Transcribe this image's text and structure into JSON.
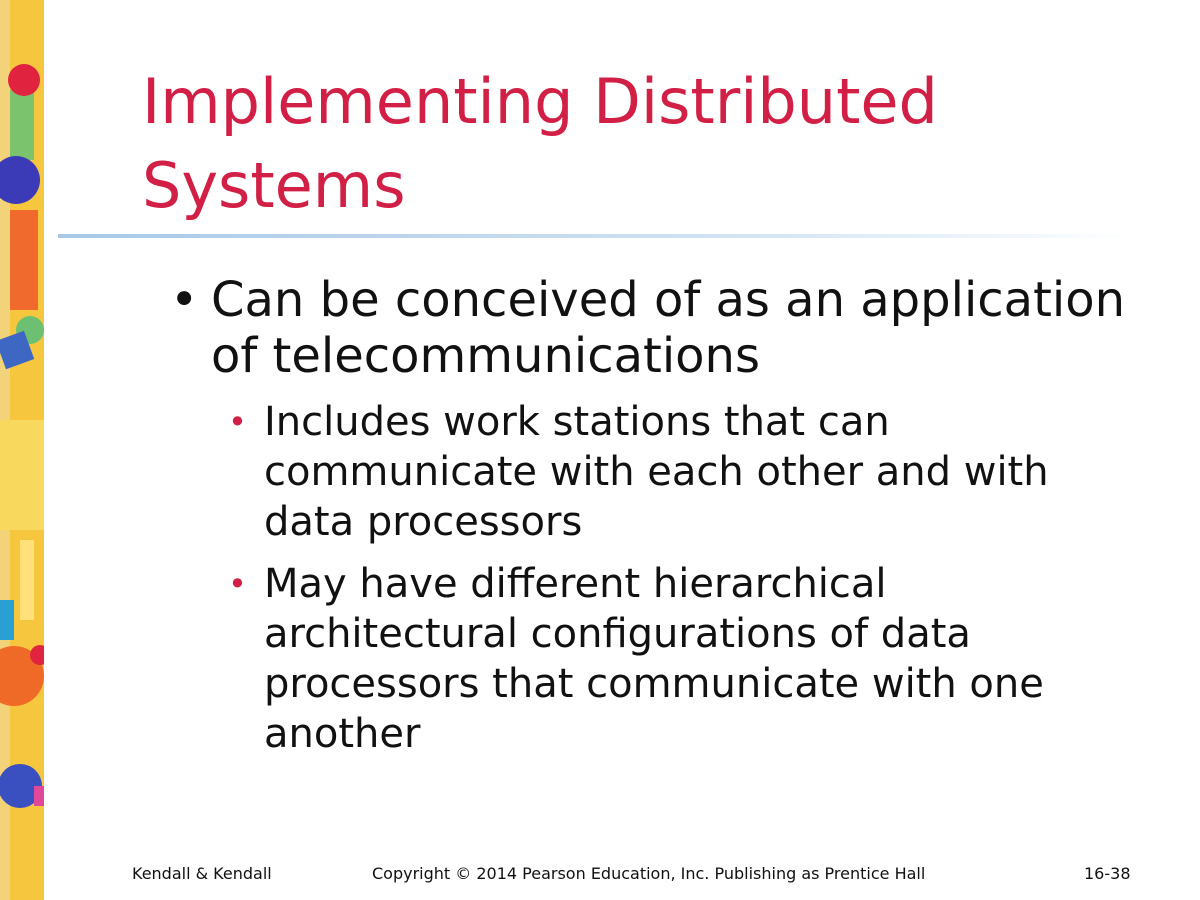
{
  "slide": {
    "title": "Implementing Distributed Systems",
    "bullet_main": "Can be conceived of as an application of telecommunications",
    "sub_bullets": [
      "Includes work stations that can communicate with each other and with data processors",
      "May have different hierarchical architectural configurations of data processors that communicate with one another"
    ]
  },
  "footer": {
    "left": "Kendall & Kendall",
    "center": "Copyright © 2014 Pearson Education, Inc. Publishing as Prentice Hall",
    "right": "16-38"
  },
  "colors": {
    "title": "#d21f45",
    "sub_bullet_marker": "#d21f45",
    "body_text": "#111111",
    "rule": "#a9c8e6",
    "side_strip": "#f6c73e"
  },
  "icons": {
    "bullet_main": "bullet-dot",
    "bullet_sub": "bullet-dot"
  }
}
